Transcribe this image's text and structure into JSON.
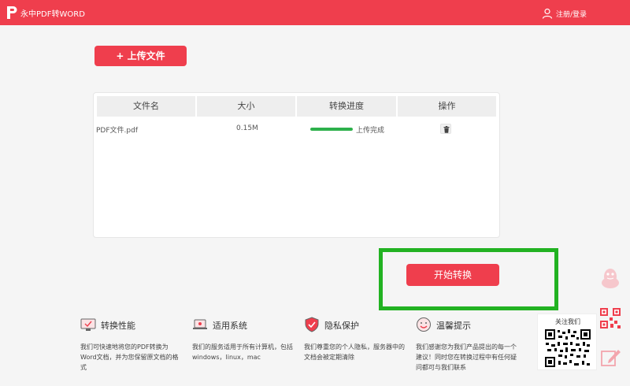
{
  "header": {
    "app_title": "永中PDF转WORD",
    "login_label": "注册/登录"
  },
  "upload_button": {
    "label": "+ 上传文件"
  },
  "file_table": {
    "columns": [
      "文件名",
      "大小",
      "转换进度",
      "操作"
    ],
    "rows": [
      {
        "name": "PDF文件.pdf",
        "size": "0.15M",
        "progress": 1.0,
        "status": "上传完成"
      }
    ]
  },
  "start_button": {
    "label": "开始转换"
  },
  "features": [
    {
      "icon": "monitor-check-icon",
      "title": "转换性能",
      "desc": "我们可快速地将您的PDF转换为Word文档，并为您保留原文档的格式"
    },
    {
      "icon": "laptop-icon",
      "title": "适用系统",
      "desc": "我们的服务适用于所有计算机，包括windows，linux，mac"
    },
    {
      "icon": "shield-check-icon",
      "title": "隐私保护",
      "desc": "我们尊重您的个人隐私，服务器中的文档会被定期清除"
    },
    {
      "icon": "smile-face-icon",
      "title": "温馨提示",
      "desc": "我们感谢您为我们产品提出的每一个建议！同时您在转换过程中有任何疑问都可与我们联系"
    }
  ],
  "follow_us": {
    "label": "关注我们"
  },
  "colors": {
    "brand": "#ef3e4d",
    "progress": "#2db04b",
    "highlight": "#22b222"
  }
}
